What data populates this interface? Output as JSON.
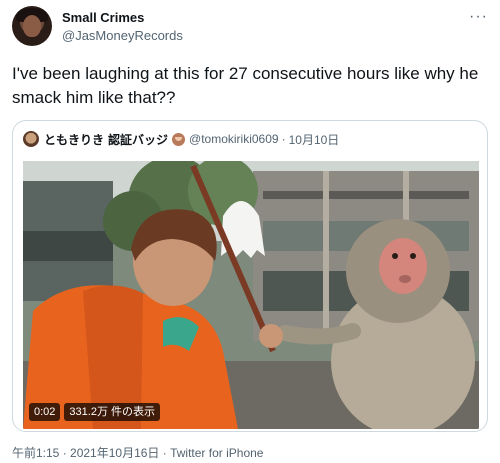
{
  "author": {
    "name": "Small Crimes",
    "handle": "@JasMoneyRecords"
  },
  "more_icon": "more-dots-icon",
  "tweet_text": "I've been laughing at this for 27 consecutive hours like why he smack him like that??",
  "quoted": {
    "name": "ともきりき",
    "badge_label": "認証バッジ",
    "handle": "@tomokiriki0609",
    "separator": "·",
    "date": "10月10日",
    "video": {
      "timestamp": "0:02",
      "views": "331.2万 件の表示"
    }
  },
  "meta": {
    "time_date": "午前1:15 · 2021年10月16日 ·",
    "source": "Twitter for iPhone"
  },
  "colors": {
    "text_primary": "#0f1419",
    "text_secondary": "#536471",
    "border": "#cfd9de"
  }
}
